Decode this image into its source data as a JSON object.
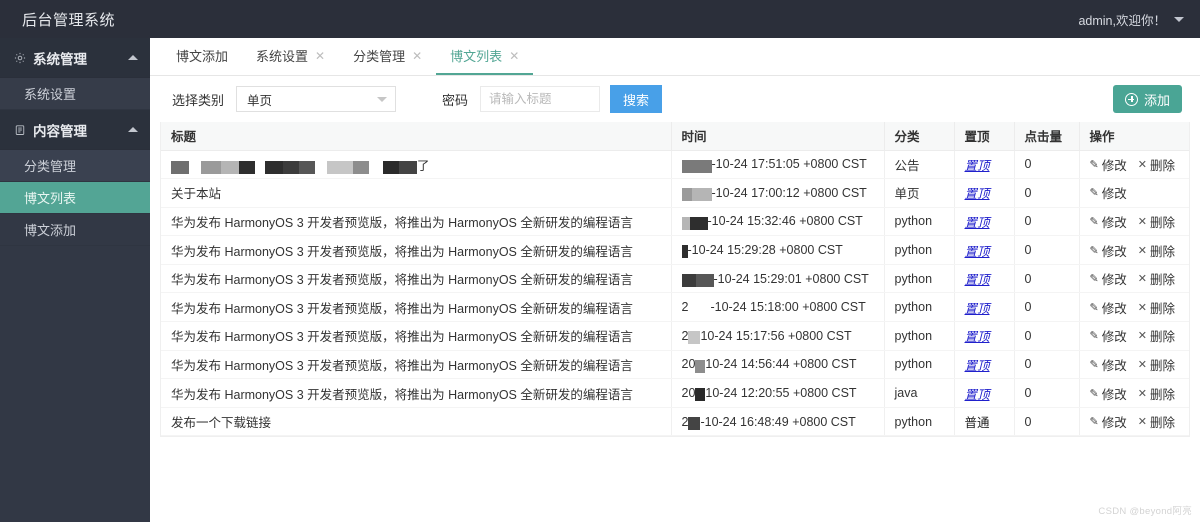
{
  "header": {
    "title": "后台管理系统",
    "user_text": "admin,欢迎你！",
    "caret_icon": "chevron-down-icon"
  },
  "sidebar": {
    "groups": [
      {
        "label": "系统管理",
        "icon": "gear-icon",
        "arrow": "chevron-up-icon",
        "items": [
          {
            "label": "系统设置",
            "active": false
          }
        ]
      },
      {
        "label": "内容管理",
        "icon": "clipboard-icon",
        "arrow": "chevron-up-icon",
        "items": [
          {
            "label": "分类管理",
            "active": false
          },
          {
            "label": "博文列表",
            "active": true
          },
          {
            "label": "博文添加",
            "active": false
          }
        ]
      }
    ]
  },
  "tabs": [
    {
      "label": "博文添加",
      "closable": false,
      "active": false
    },
    {
      "label": "系统设置",
      "closable": true,
      "active": false
    },
    {
      "label": "分类管理",
      "closable": true,
      "active": false
    },
    {
      "label": "博文列表",
      "closable": true,
      "active": true
    }
  ],
  "tab_close_icon": "close-icon",
  "filter": {
    "category_label": "选择类别",
    "category_value": "单页",
    "category_caret": "chevron-down-icon",
    "keyword_label": "密码",
    "keyword_value": "",
    "keyword_placeholder": "请输入标题",
    "search_button": "搜索",
    "add_button": "添加",
    "add_icon": "plus-circle-icon"
  },
  "table": {
    "columns": [
      "标题",
      "时间",
      "分类",
      "置顶",
      "点击量",
      "操作"
    ],
    "ops": {
      "edit_label": "修改",
      "edit_icon": "pencil-icon",
      "delete_label": "删除",
      "delete_icon": "close-icon"
    },
    "rows": [
      {
        "title": "",
        "title_redacted": true,
        "title_tail": "了",
        "time_redacted": true,
        "time": "-10-24 17:51:05 +0800 CST",
        "category": "公告",
        "top": "置顶",
        "top_is_link": true,
        "hits": "0",
        "can_delete": true
      },
      {
        "title": "关于本站",
        "title_redacted": false,
        "time_redacted": true,
        "time": "-10-24 17:00:12 +0800 CST",
        "category": "单页",
        "top": "置顶",
        "top_is_link": true,
        "hits": "0",
        "can_delete": false
      },
      {
        "title": "华为发布 HarmonyOS 3 开发者预览版，将推出为 HarmonyOS 全新研发的编程语言",
        "title_redacted": false,
        "time_redacted": true,
        "time": "-10-24 15:32:46 +0800 CST",
        "category": "python",
        "top": "置顶",
        "top_is_link": true,
        "hits": "0",
        "can_delete": true
      },
      {
        "title": "华为发布 HarmonyOS 3 开发者预览版，将推出为 HarmonyOS 全新研发的编程语言",
        "title_redacted": false,
        "time_redacted": true,
        "time": "-10-24 15:29:28 +0800 CST",
        "category": "python",
        "top": "置顶",
        "top_is_link": true,
        "hits": "0",
        "can_delete": true
      },
      {
        "title": "华为发布 HarmonyOS 3 开发者预览版，将推出为 HarmonyOS 全新研发的编程语言",
        "title_redacted": false,
        "time_redacted": true,
        "time": "-10-24 15:29:01 +0800 CST",
        "category": "python",
        "top": "置顶",
        "top_is_link": true,
        "hits": "0",
        "can_delete": true
      },
      {
        "title": "华为发布 HarmonyOS 3 开发者预览版，将推出为 HarmonyOS 全新研发的编程语言",
        "title_redacted": false,
        "time_redacted": true,
        "time_prefix": "2",
        "time": "-10-24 15:18:00 +0800 CST",
        "category": "python",
        "top": "置顶",
        "top_is_link": true,
        "hits": "0",
        "can_delete": true
      },
      {
        "title": "华为发布 HarmonyOS 3 开发者预览版，将推出为 HarmonyOS 全新研发的编程语言",
        "title_redacted": false,
        "time_redacted": true,
        "time_prefix": "2",
        "time": "10-24 15:17:56 +0800 CST",
        "category": "python",
        "top": "置顶",
        "top_is_link": true,
        "hits": "0",
        "can_delete": true
      },
      {
        "title": "华为发布 HarmonyOS 3 开发者预览版，将推出为 HarmonyOS 全新研发的编程语言",
        "title_redacted": false,
        "time_redacted": true,
        "time_prefix": "20",
        "time": "10-24 14:56:44 +0800 CST",
        "category": "python",
        "top": "置顶",
        "top_is_link": true,
        "hits": "0",
        "can_delete": true
      },
      {
        "title": "华为发布 HarmonyOS 3 开发者预览版，将推出为 HarmonyOS 全新研发的编程语言",
        "title_redacted": false,
        "time_redacted": true,
        "time_prefix": "20",
        "time": "10-24 12:20:55 +0800 CST",
        "category": "java",
        "top": "置顶",
        "top_is_link": true,
        "hits": "0",
        "can_delete": true
      },
      {
        "title": "发布一个下载链接",
        "title_redacted": false,
        "time_redacted": true,
        "time_prefix": "2",
        "time": "-10-24 16:48:49 +0800 CST",
        "category": "python",
        "top": "普通",
        "top_is_link": false,
        "hits": "0",
        "can_delete": true
      }
    ]
  },
  "watermark": "CSDN @beyond阿亮",
  "colors": {
    "topbar_bg": "#2b2f3a",
    "sidebar_bg": "#323845",
    "accent_green": "#4aa595",
    "accent_blue": "#48a0e8",
    "link_blue": "#2020cc"
  }
}
